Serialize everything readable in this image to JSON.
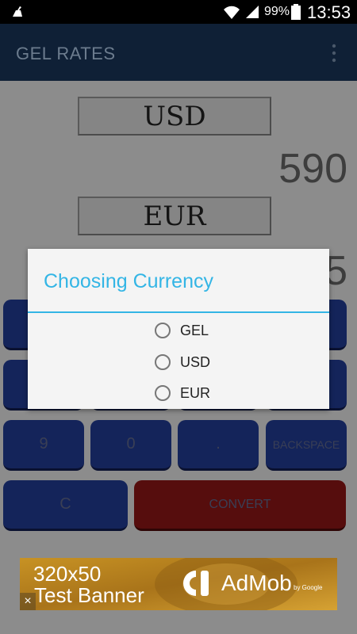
{
  "status_bar": {
    "battery": "99%",
    "time": "13:53"
  },
  "app_bar": {
    "title": "GEL RATES"
  },
  "converter": {
    "from_currency": "USD",
    "from_value": "590",
    "to_currency": "EUR",
    "to_value": "5"
  },
  "keypad": {
    "row3": [
      "9",
      "0",
      "."
    ],
    "backspace": "BACKSPACE",
    "clear": "C",
    "convert": "CONVERT"
  },
  "dialog": {
    "title": "Choosing Currency",
    "options": [
      "GEL",
      "USD",
      "EUR"
    ]
  },
  "ad": {
    "line1": "320x50",
    "line2": "Test Banner",
    "brand": "AdMob",
    "by": "by Google",
    "close": "×"
  },
  "colors": {
    "accent": "#33b5e5",
    "key_blue": "#14245a",
    "key_red": "#560d0d",
    "action_bar": "#0f2036"
  }
}
